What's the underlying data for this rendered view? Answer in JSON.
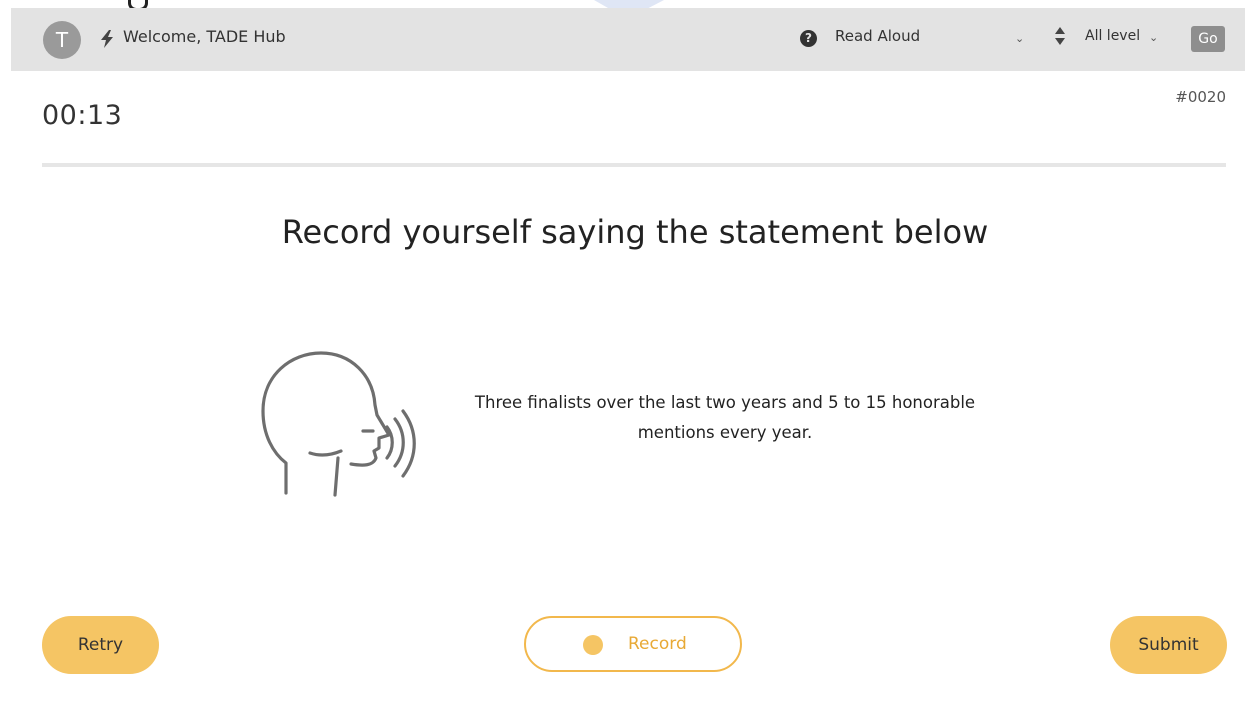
{
  "header": {
    "avatar_initial": "T",
    "welcome_text": "Welcome, TADE Hub",
    "task_type": "Read Aloud",
    "level": "All level",
    "go_label": "Go"
  },
  "task": {
    "timer": "00:13",
    "question_id": "#0020",
    "instruction": "Record yourself saying the statement below",
    "statement": "Three finalists over the last two years and 5 to 15 honorable mentions every year."
  },
  "actions": {
    "retry_label": "Retry",
    "record_label": "Record",
    "submit_label": "Submit"
  },
  "icons": {
    "help": "question-circle-icon",
    "bolt": "bolt-icon",
    "sort": "sort-icon",
    "speaker": "speaking-head-icon"
  },
  "colors": {
    "accent": "#f5c564",
    "record_text": "#e8a935",
    "topbar": "#e3e3e3",
    "go_button": "#8e8e8e"
  }
}
